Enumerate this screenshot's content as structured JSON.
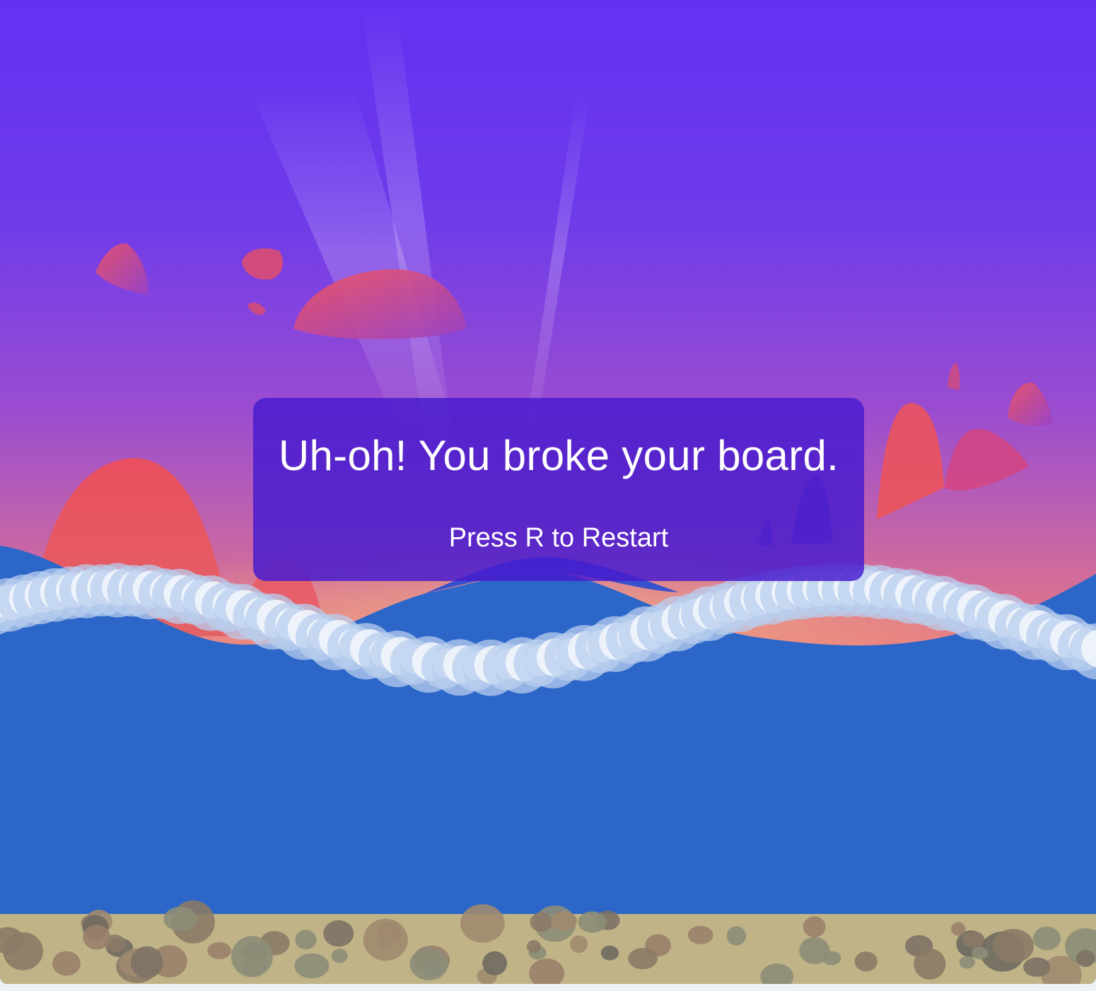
{
  "game_over": {
    "title": "Uh-oh! You broke your board.",
    "restart_hint": "Press R to Restart",
    "restart_key": "R"
  },
  "colors": {
    "sky_top": "#6331f2",
    "sky_middle": "#a251c6",
    "sky_horizon": "#f3bf6b",
    "ocean": "#2b66c8",
    "sand": "#bfb387",
    "overlay": "#481cce",
    "foam": "#ffffff"
  }
}
